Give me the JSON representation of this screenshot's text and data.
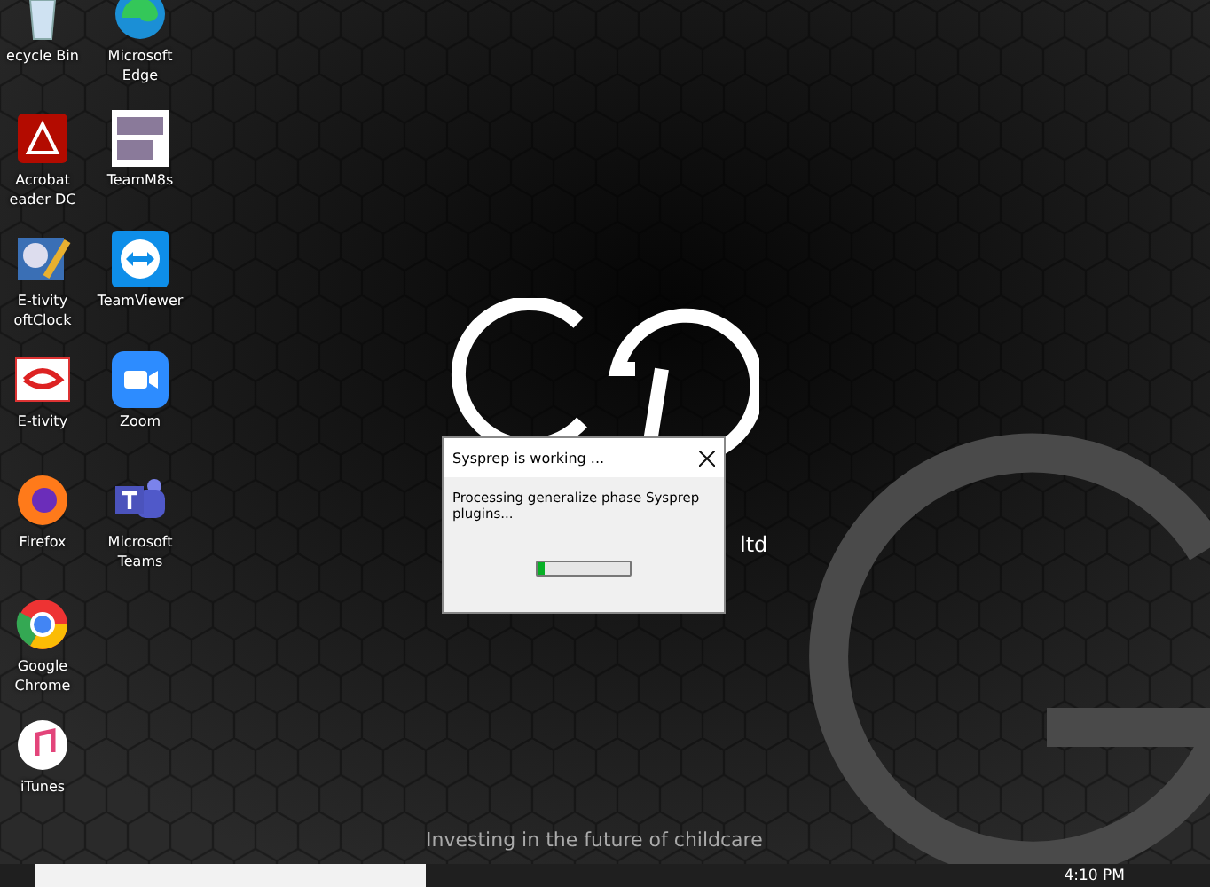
{
  "desktop_icons": [
    [
      {
        "kind": "recycle",
        "label": [
          "ecycle Bin"
        ]
      },
      {
        "kind": "acrobat",
        "label": [
          "Acrobat",
          "eader DC"
        ]
      },
      {
        "kind": "softclock",
        "label": [
          "E-tivity",
          "oftClock"
        ]
      },
      {
        "kind": "etivity",
        "label": [
          "E-tivity"
        ]
      },
      {
        "kind": "firefox",
        "label": [
          "Firefox"
        ]
      },
      {
        "kind": "chrome",
        "label": [
          "Google",
          "Chrome"
        ]
      },
      {
        "kind": "itunes",
        "label": [
          "iTunes"
        ]
      }
    ],
    [
      {
        "kind": "edge",
        "label": [
          "Microsoft",
          "Edge"
        ]
      },
      {
        "kind": "teamm8s",
        "label": [
          "TeamM8s"
        ]
      },
      {
        "kind": "teamviewer",
        "label": [
          "TeamViewer"
        ]
      },
      {
        "kind": "zoom",
        "label": [
          "Zoom"
        ]
      },
      {
        "kind": "teams",
        "label": [
          "Microsoft",
          "Teams"
        ]
      }
    ]
  ],
  "wallpaper": {
    "suffix": "ltd",
    "tagline": "Investing in the future of childcare"
  },
  "dialog": {
    "title": "Sysprep is working ...",
    "message": "Processing generalize phase Sysprep plugins...",
    "progress": {
      "level": 0.08
    }
  },
  "taskbar": {
    "time": "4:10 PM"
  }
}
